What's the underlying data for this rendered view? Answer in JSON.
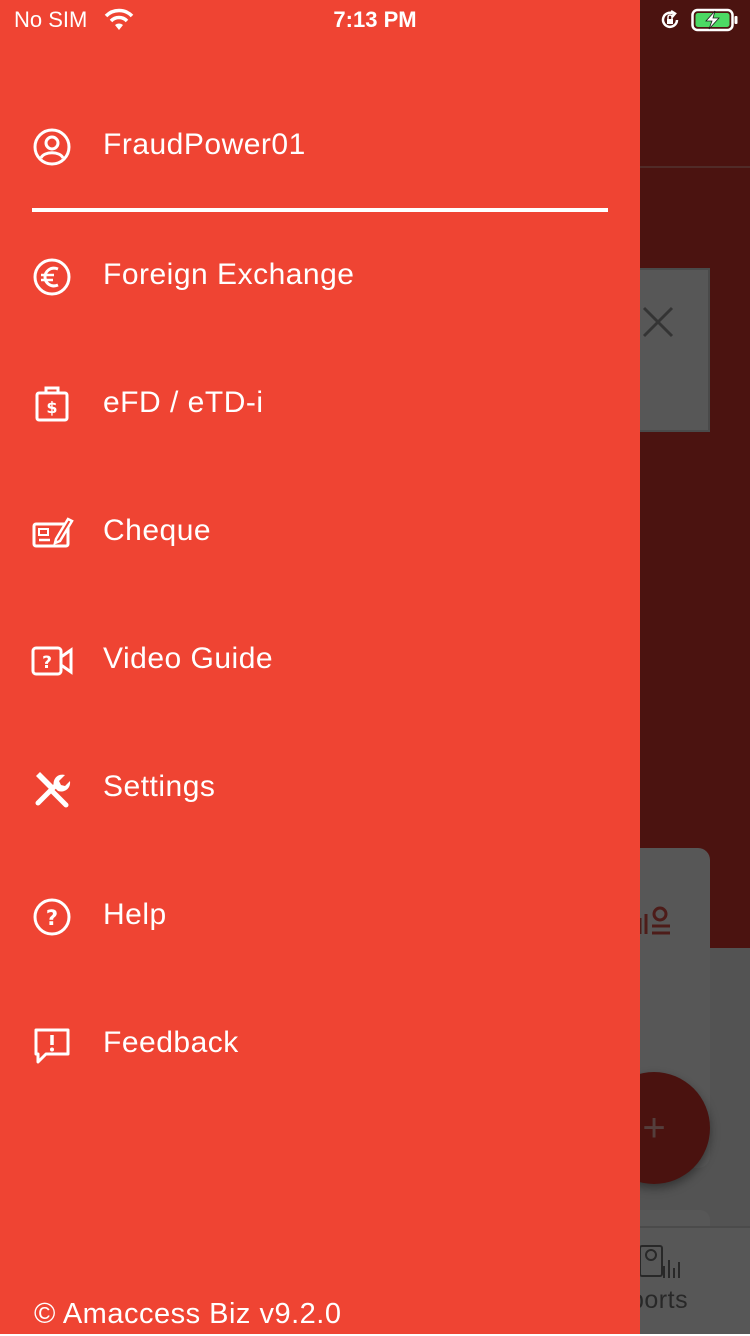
{
  "status_bar": {
    "carrier": "No SIM",
    "time": "7:13 PM"
  },
  "drawer": {
    "username": "FraudPower01",
    "menu": [
      {
        "label": "Foreign Exchange",
        "icon": "euro-icon"
      },
      {
        "label": "eFD / eTD-i",
        "icon": "briefcase-dollar-icon"
      },
      {
        "label": "Cheque",
        "icon": "cheque-icon"
      },
      {
        "label": "Video Guide",
        "icon": "video-help-icon"
      },
      {
        "label": "Settings",
        "icon": "tools-icon"
      },
      {
        "label": "Help",
        "icon": "question-icon"
      },
      {
        "label": "Feedback",
        "icon": "feedback-icon"
      }
    ],
    "footer": "© Amaccess Biz v9.2.0"
  },
  "background": {
    "tab_label_partial": "ports"
  },
  "colors": {
    "drawer": "#ef4433",
    "header": "#dd3a2f",
    "text": "#ffffff"
  }
}
